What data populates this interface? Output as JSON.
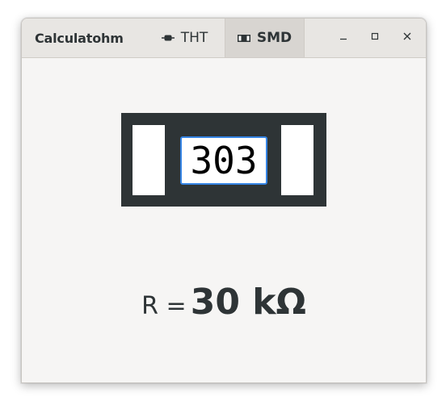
{
  "window": {
    "title": "Calculatohm"
  },
  "tabs": [
    {
      "label": "THT",
      "icon": "tht-resistor-icon",
      "active": false
    },
    {
      "label": "SMD",
      "icon": "smd-resistor-icon",
      "active": true
    }
  ],
  "window_controls": {
    "minimize": "minimize-icon",
    "maximize": "maximize-icon",
    "close": "close-icon"
  },
  "smd": {
    "code_value": "303"
  },
  "result": {
    "prefix": "R =",
    "value": "30 kΩ"
  },
  "colors": {
    "accent": "#3584e4",
    "resistor_body": "#2e3436",
    "background": "#f6f5f4",
    "headerbar": "#e8e6e3"
  }
}
